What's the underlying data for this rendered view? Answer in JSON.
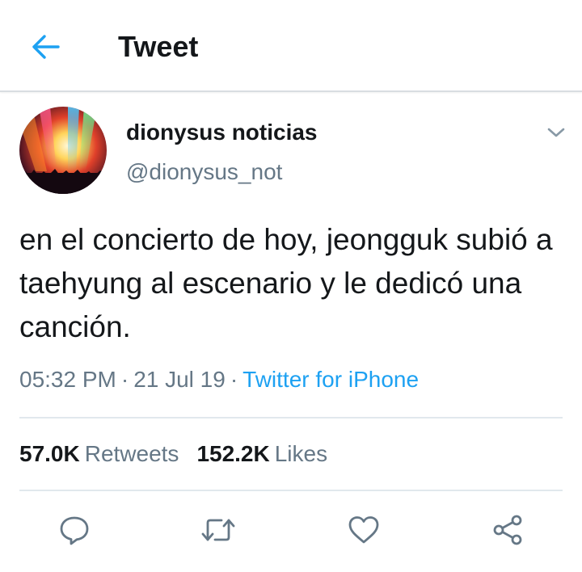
{
  "header": {
    "title": "Tweet",
    "back_icon": "arrow-left-icon",
    "accent_color": "#1da1f2"
  },
  "tweet": {
    "author": {
      "display_name": "dionysus noticias",
      "handle": "@dionysus_not",
      "avatar": "concert-lights-avatar"
    },
    "caret_icon": "chevron-down-icon",
    "text": "en el concierto de hoy, jeongguk subió a taehyung al escenario y le dedicó una canción.",
    "time": "05:32 PM",
    "date": "21 Jul 19",
    "separator": "·",
    "source": "Twitter for iPhone"
  },
  "stats": {
    "retweets_count": "57.0K",
    "retweets_label": "Retweets",
    "likes_count": "152.2K",
    "likes_label": "Likes"
  },
  "actions": [
    {
      "name": "reply",
      "icon": "reply-icon"
    },
    {
      "name": "retweet",
      "icon": "retweet-icon"
    },
    {
      "name": "like",
      "icon": "heart-icon"
    },
    {
      "name": "share",
      "icon": "share-icon"
    }
  ],
  "colors": {
    "text_primary": "#14171a",
    "text_secondary": "#657786",
    "link": "#1da1f2",
    "divider": "#e1e8ed"
  }
}
